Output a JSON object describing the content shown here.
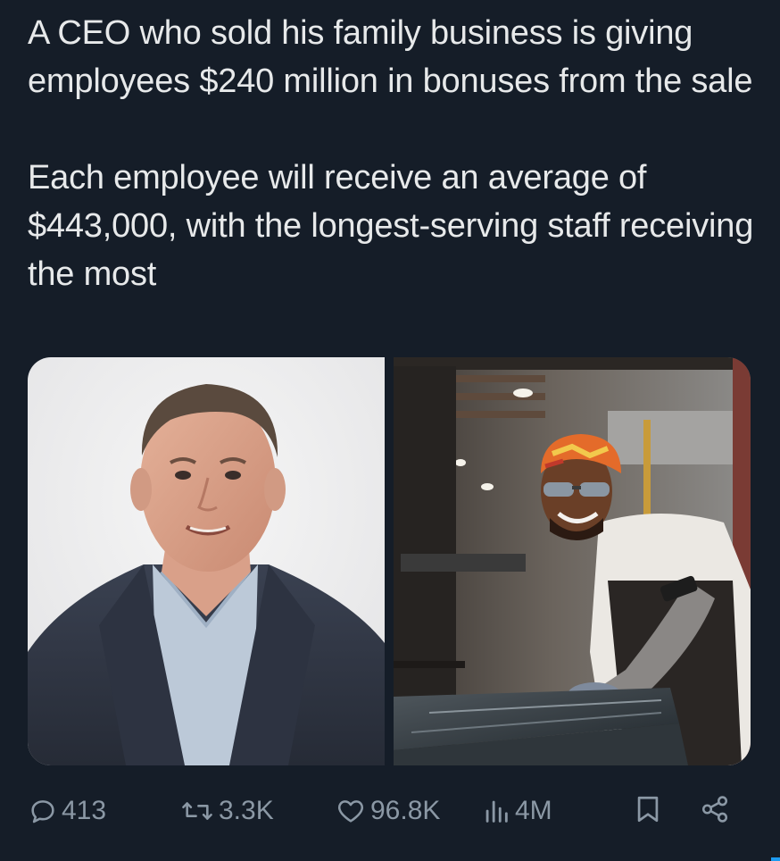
{
  "tweet": {
    "text_line_1": "A CEO who sold his family business is giving employees $240 million in bonuses from the sale",
    "text_line_2": "Each employee will receive an average of $443,000, with the longest-serving staff receiving the most"
  },
  "media": {
    "images": [
      {
        "depicts": "ceo-portrait"
      },
      {
        "depicts": "factory-worker"
      }
    ]
  },
  "actions": {
    "reply_count": "413",
    "retweet_count": "3.3K",
    "like_count": "96.8K",
    "view_count": "4M"
  },
  "icons": {
    "reply": "reply-icon",
    "retweet": "retweet-icon",
    "like": "heart-icon",
    "views": "views-icon",
    "bookmark": "bookmark-icon",
    "share": "share-icon"
  },
  "colors": {
    "background": "#151d28",
    "text": "#e7e9ea",
    "muted": "#8b98a5",
    "accent": "#1d9bf0"
  }
}
